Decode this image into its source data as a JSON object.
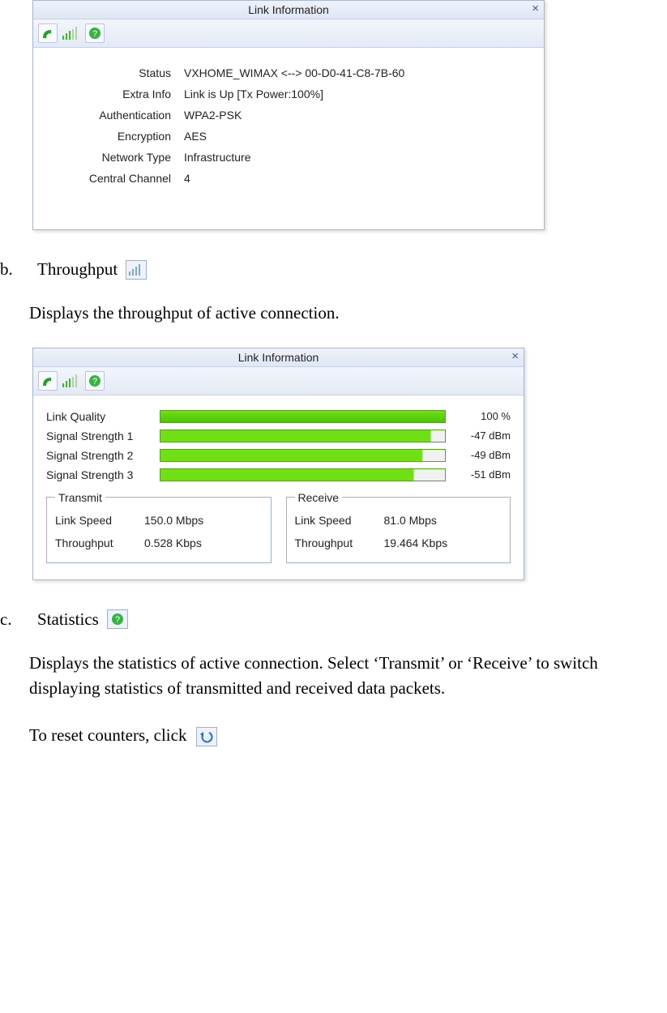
{
  "window": {
    "title": "Link Information",
    "close_glyph": "×"
  },
  "status_rows": [
    {
      "label": "Status",
      "value": "VXHOME_WIMAX <--> 00-D0-41-C8-7B-60"
    },
    {
      "label": "Extra Info",
      "value": "Link is Up  [Tx Power:100%]"
    },
    {
      "label": "Authentication",
      "value": "WPA2-PSK"
    },
    {
      "label": "Encryption",
      "value": "AES"
    },
    {
      "label": "Network Type",
      "value": "Infrastructure"
    },
    {
      "label": "Central Channel",
      "value": "4"
    }
  ],
  "sections": {
    "b": {
      "marker": "b.",
      "title": "Throughput",
      "desc": "Displays the throughput of active connection."
    },
    "c": {
      "marker": "c.",
      "title": "Statistics",
      "desc": "Displays the statistics of active connection. Select ‘Transmit’ or ‘Receive’ to switch displaying statistics of transmitted and received data packets.",
      "reset": "To reset counters, click"
    }
  },
  "signals": [
    {
      "label": "Link Quality",
      "value": "100 %",
      "cls": ""
    },
    {
      "label": "Signal Strength 1",
      "value": "-47 dBm",
      "cls": "p95"
    },
    {
      "label": "Signal Strength 2",
      "value": "-49 dBm",
      "cls": "p92"
    },
    {
      "label": "Signal Strength 3",
      "value": "-51 dBm",
      "cls": "p89"
    }
  ],
  "tx": {
    "legend": "Transmit",
    "rows": [
      {
        "label": "Link Speed",
        "value": "150.0 Mbps"
      },
      {
        "label": "Throughput",
        "value": "0.528 Kbps"
      }
    ]
  },
  "rx": {
    "legend": "Receive",
    "rows": [
      {
        "label": "Link Speed",
        "value": "81.0 Mbps"
      },
      {
        "label": "Throughput",
        "value": "19.464 Kbps"
      }
    ]
  }
}
